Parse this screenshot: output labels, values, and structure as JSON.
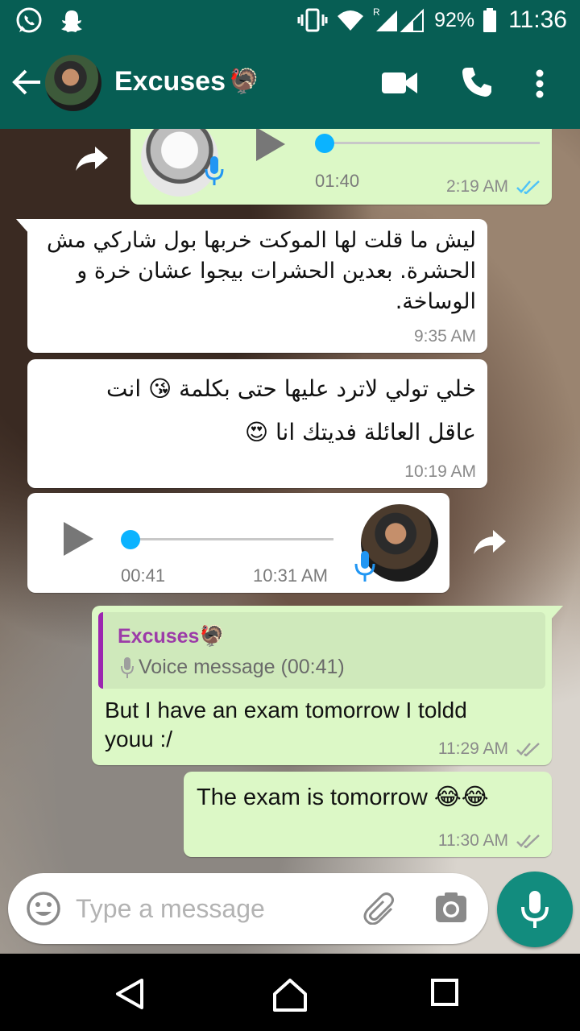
{
  "status_bar": {
    "battery_percent": "92%",
    "time": "11:36",
    "roaming_indicator": "R",
    "icons": [
      "whatsapp-icon",
      "snapchat-icon",
      "vibrate-icon",
      "wifi-icon",
      "signal-icon",
      "battery-icon"
    ]
  },
  "header": {
    "contact_name": "Excuses",
    "contact_emoji": "🦃",
    "icons": [
      "back-arrow-icon",
      "video-call-icon",
      "phone-icon",
      "more-vert-icon"
    ]
  },
  "messages": [
    {
      "type": "voice",
      "direction": "outgoing",
      "duration": "01:40",
      "time": "2:19 AM",
      "status": "read"
    },
    {
      "type": "text",
      "direction": "incoming",
      "lines": [
        "ليش ما قلت لها الموكت خربها بول شاركي مش",
        "الحشرة.  بعدين الحشرات بيجوا عشان خرة و",
        "الوساخة."
      ],
      "time": "9:35 AM"
    },
    {
      "type": "text",
      "direction": "incoming",
      "lines": [
        "خلي تولي  لاترد عليها حتى بكلمة 😘 انت",
        "عاقل العائلة فديتك انا 😍"
      ],
      "time": "10:19 AM"
    },
    {
      "type": "voice",
      "direction": "incoming",
      "duration": "00:41",
      "time": "10:31 AM"
    },
    {
      "type": "reply",
      "direction": "outgoing",
      "quote_name": "Excuses🦃",
      "quote_text": "Voice message (00:41)",
      "lines": [
        "But I have an exam tomorrow I toldd",
        "youu :/"
      ],
      "time": "11:29 AM",
      "status": "delivered"
    },
    {
      "type": "text",
      "direction": "outgoing",
      "text": "The exam is tomorrow 😂😂",
      "time": "11:30 AM",
      "status": "delivered"
    }
  ],
  "composer": {
    "placeholder": "Type a message",
    "icons": [
      "emoji-icon",
      "attach-icon",
      "camera-icon",
      "mic-icon"
    ]
  },
  "nav_bar": {
    "icons": [
      "back-triangle-icon",
      "home-icon",
      "recents-icon"
    ]
  },
  "colors": {
    "header_bg": "#075e54",
    "outgoing_bubble": "#dcf8c6",
    "incoming_bubble": "#ffffff",
    "read_ticks": "#4fc3f7",
    "accent_fab": "#128c7e",
    "voice_knob": "#0bb3ff"
  }
}
